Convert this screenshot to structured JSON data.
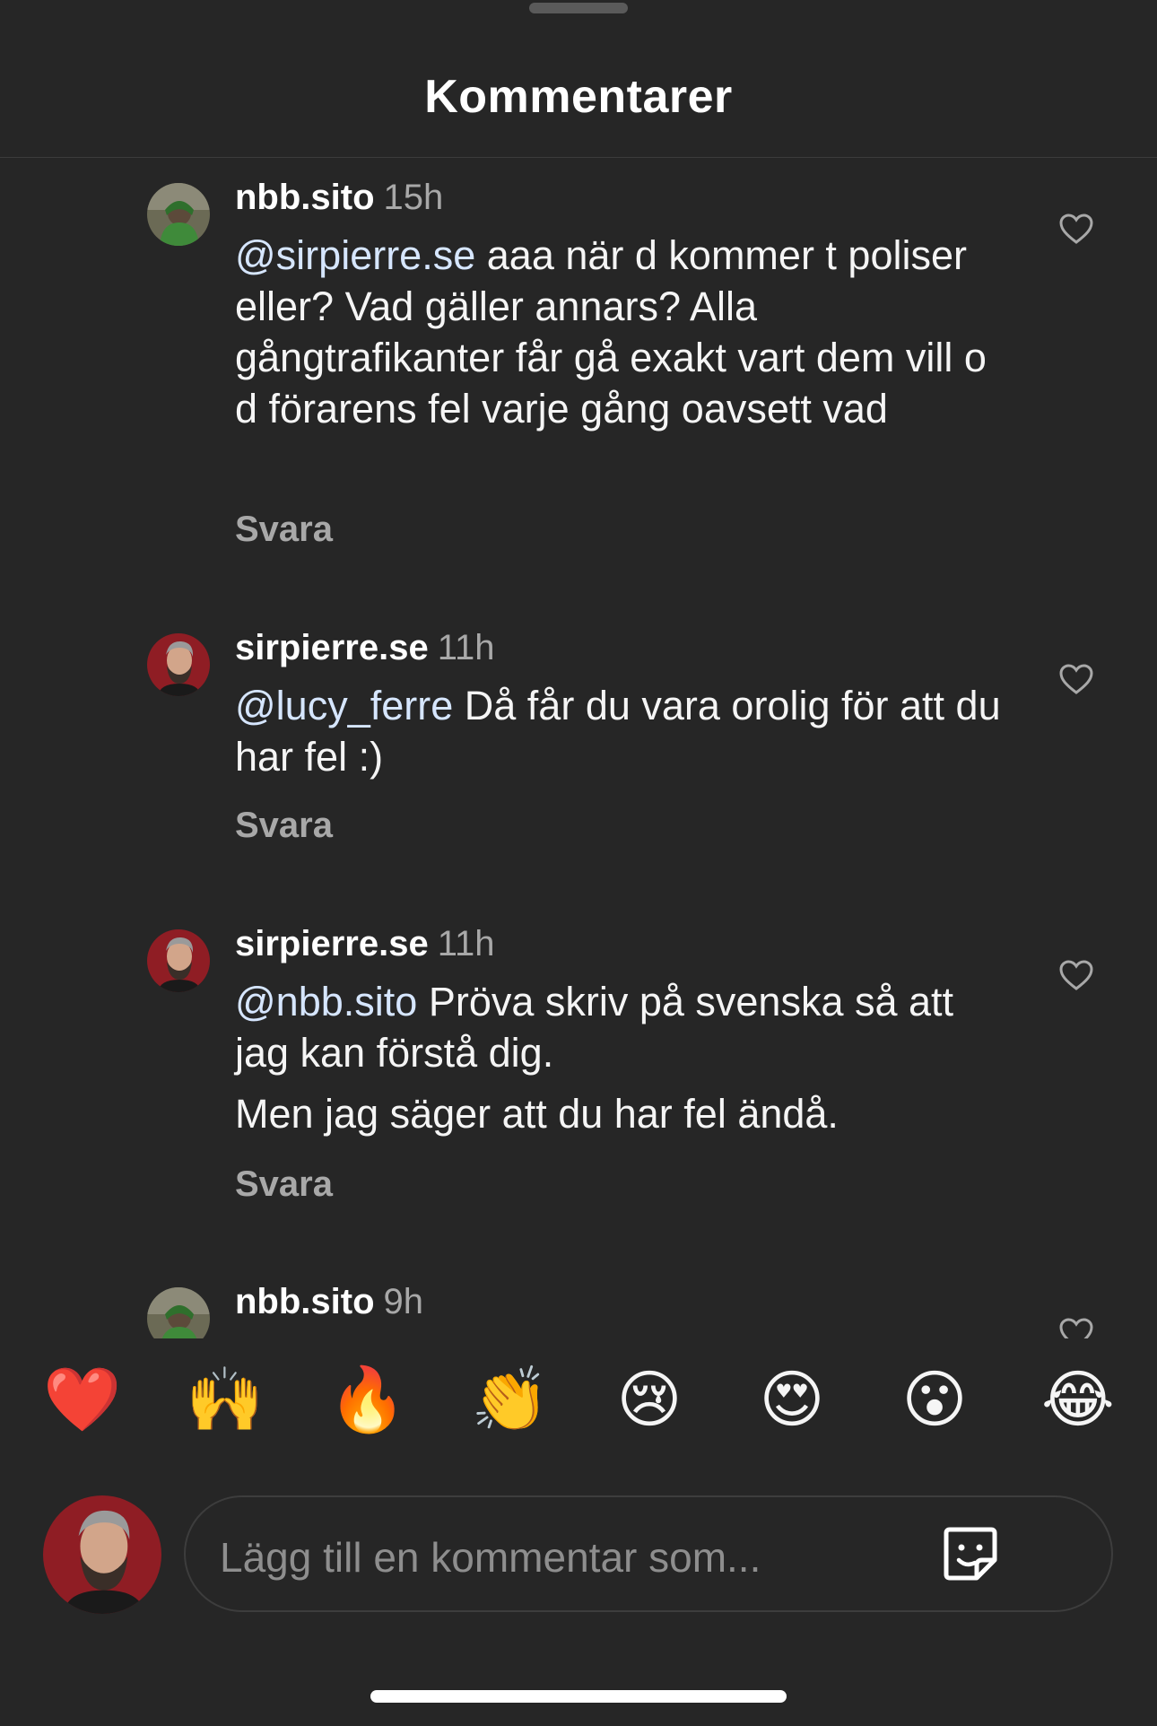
{
  "header": {
    "title": "Kommentarer"
  },
  "comments": [
    {
      "username": "nbb.sito",
      "time": "15h",
      "mention": "@sirpierre.se",
      "paragraphs": [
        "aaa när d kommer t poliser eller? Vad gäller annars? Alla gångtrafikanter får gå exakt vart dem vill o d förarens fel varje gång oavsett vad"
      ],
      "reply_label": "Svara",
      "avatar": "green-hoodie-avatar"
    },
    {
      "username": "sirpierre.se",
      "time": "11h",
      "mention": "@lucy_ferre",
      "paragraphs": [
        "Då får du vara orolig för att du har fel :)"
      ],
      "reply_label": "Svara",
      "avatar": "bearded-man-avatar"
    },
    {
      "username": "sirpierre.se",
      "time": "11h",
      "mention": "@nbb.sito",
      "paragraphs": [
        "Pröva skriv på svenska så att jag kan förstå dig.",
        "Men jag säger att du har fel ändå."
      ],
      "reply_label": "Svara",
      "avatar": "bearded-man-avatar"
    },
    {
      "username": "nbb.sito",
      "time": "9h",
      "avatar": "green-hoodie-avatar"
    }
  ],
  "reactions": [
    "❤️",
    "🙌",
    "🔥",
    "👏",
    "😢",
    "😍",
    "😮",
    "😂"
  ],
  "composer": {
    "placeholder": "Lägg till en kommentar som...",
    "sticker_icon": "sticker-icon"
  },
  "colors": {
    "background": "#262626",
    "mention": "#d6e6ff",
    "secondary_text": "#a8a8a8"
  }
}
